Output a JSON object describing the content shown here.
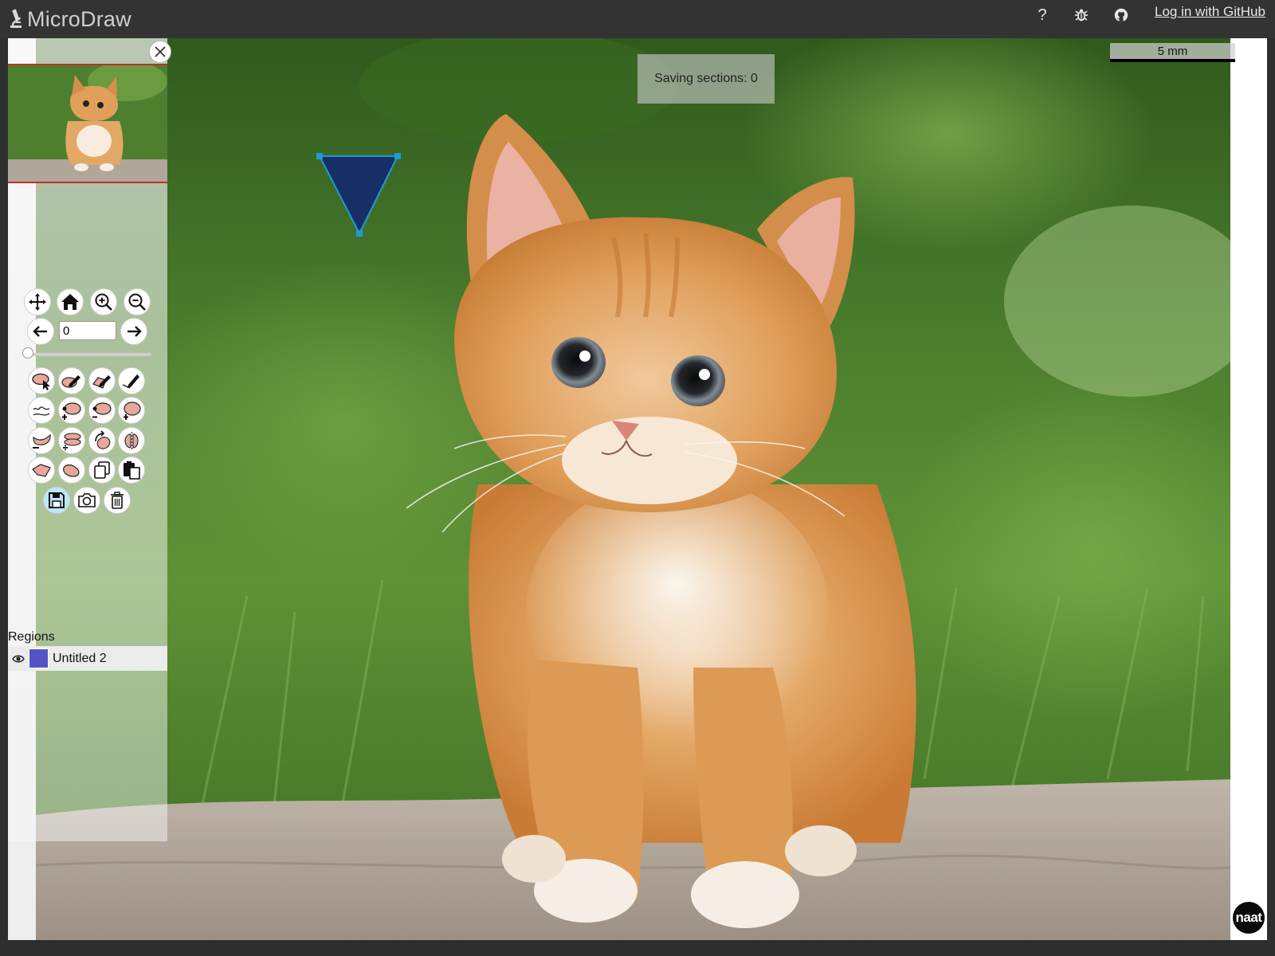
{
  "app": {
    "title": "MicroDraw"
  },
  "topbar": {
    "help_icon": "question-icon",
    "help_label": "?",
    "bug_icon": "bug-icon",
    "github_icon": "github-icon",
    "login_label": "Log in with GitHub"
  },
  "viewer": {
    "saving_text": "Saving sections: 0",
    "scale_label": "5 mm",
    "badge_label": "naat",
    "image_subject": "kitten-photo"
  },
  "navigation": {
    "slice_value": "0",
    "slider_fraction": 0.0
  },
  "toolbar": {
    "icons": [
      "move-icon",
      "home-icon",
      "zoom-in-icon",
      "zoom-out-icon",
      "previous-arrow-icon",
      "next-arrow-icon",
      "select-region-icon",
      "draw-icon",
      "draw-polygon-icon",
      "draw-line-icon",
      "simplify-icon",
      "add-point-icon",
      "delete-point-icon",
      "add-region-icon",
      "subtract-region-icon",
      "split-region-icon",
      "rotate-region-icon",
      "flip-region-icon",
      "to-polygon-icon",
      "to-bezier-icon",
      "copy-icon",
      "paste-icon",
      "save-icon",
      "screenshot-icon",
      "delete-icon"
    ]
  },
  "regions": {
    "title": "Regions",
    "items": [
      {
        "name": "Untitled 2",
        "color": "#5454c4",
        "visible": true
      }
    ]
  },
  "colors": {
    "topbar_bg": "#333333",
    "active_tool": "#bde6f7",
    "selection_handle": "#1d9bd9",
    "annotation_fill": "#14286e"
  }
}
